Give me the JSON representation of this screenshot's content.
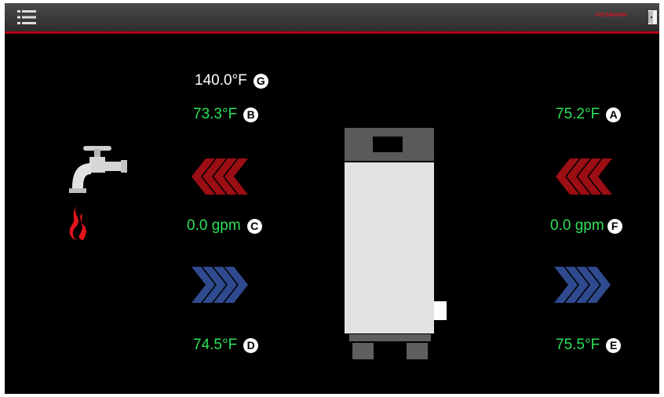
{
  "header": {
    "menu_icon": "list-icon",
    "brand": "VIESMANN",
    "exit_icon": "door-exit-icon",
    "accent_color": "#b00016"
  },
  "readings": {
    "g": {
      "value": "140.0°F",
      "badge": "G"
    },
    "b": {
      "value": "73.3°F",
      "badge": "B"
    },
    "a": {
      "value": "75.2°F",
      "badge": "A"
    },
    "c": {
      "value": "0.0 gpm",
      "badge": "C"
    },
    "f": {
      "value": "0.0 gpm",
      "badge": "F"
    },
    "d": {
      "value": "74.5°F",
      "badge": "D"
    },
    "e": {
      "value": "75.5°F",
      "badge": "E"
    }
  },
  "colors": {
    "reading_green": "#2ee05a",
    "supply_arrow": "#9b0e14",
    "return_arrow": "#2f4a8f",
    "flame": "#e0141c"
  },
  "icons": [
    "faucet-icon",
    "flame-icon",
    "boiler-icon"
  ]
}
